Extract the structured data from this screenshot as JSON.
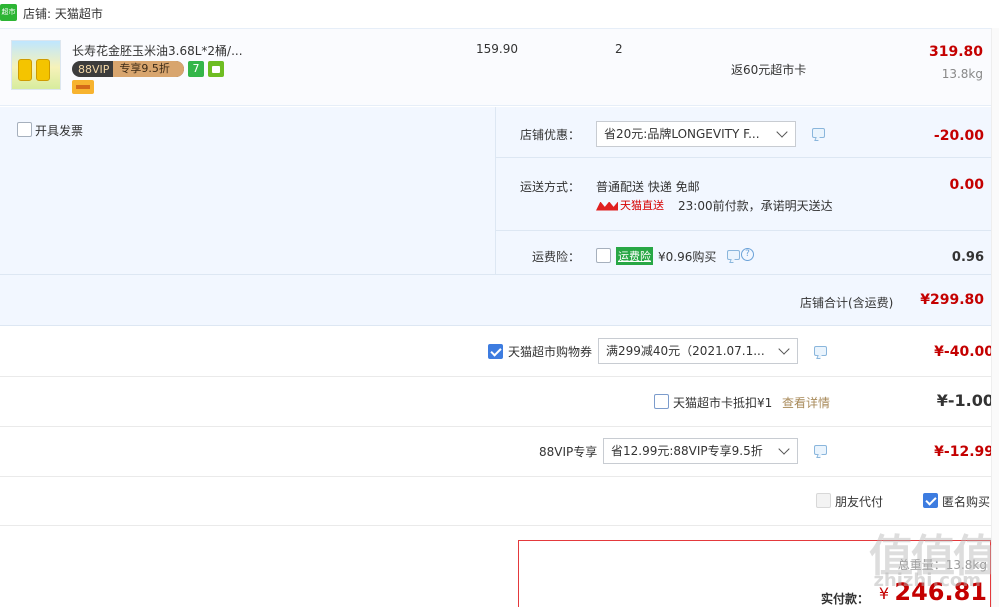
{
  "shop": {
    "logo_text": "超市",
    "label": "店铺: 天猫超市"
  },
  "product": {
    "title": "长寿花金胚玉米油3.68L*2桶/...",
    "vip_label": "88VIP",
    "vip_discount": "专享9.5折",
    "tag_seven": "7",
    "unit_price": "159.90",
    "quantity": "2",
    "cashback": "返60元超市卡",
    "line_total": "319.80",
    "weight": "13.8kg"
  },
  "invoice": {
    "label": "开具发票"
  },
  "shop_discount": {
    "label": "店铺优惠：",
    "selected": "省20元:品牌LONGEVITY F...",
    "amount": "-20.00"
  },
  "shipping": {
    "label": "运送方式：",
    "method": "普通配送 快递 免邮",
    "tmall_direct": "天猫直送",
    "promise": "23:00前付款，承诺明天送达",
    "amount": "0.00"
  },
  "insurance": {
    "label": "运费险：",
    "badge": "运费险",
    "price_text": "¥0.96购买",
    "help": "?",
    "amount": "0.96"
  },
  "shop_total": {
    "label": "店铺合计(含运费)",
    "amount": "¥299.80"
  },
  "coupon": {
    "label": "天猫超市购物券",
    "selected": "满299减40元（2021.07.1...",
    "amount": "¥-40.00"
  },
  "card_deduct": {
    "label": "天猫超市卡抵扣¥1",
    "details_link": "查看详情",
    "amount": "¥-1.00"
  },
  "vip88": {
    "label": "88VIP专享",
    "selected": "省12.99元:88VIP专享9.5折",
    "amount": "¥-12.99"
  },
  "options": {
    "friend_pay": "朋友代付",
    "anonymous": "匿名购买"
  },
  "pay": {
    "weight": "总重量：13.8kg",
    "label": "实付款：",
    "yen": "¥",
    "amount": "246.81"
  },
  "watermark": {
    "main": "值值值",
    "site": "zhizhi.com"
  },
  "colors": {
    "price_red": "#c40000",
    "accent_blue": "#3d7ce0",
    "panel_bg": "#f2f7ff"
  }
}
